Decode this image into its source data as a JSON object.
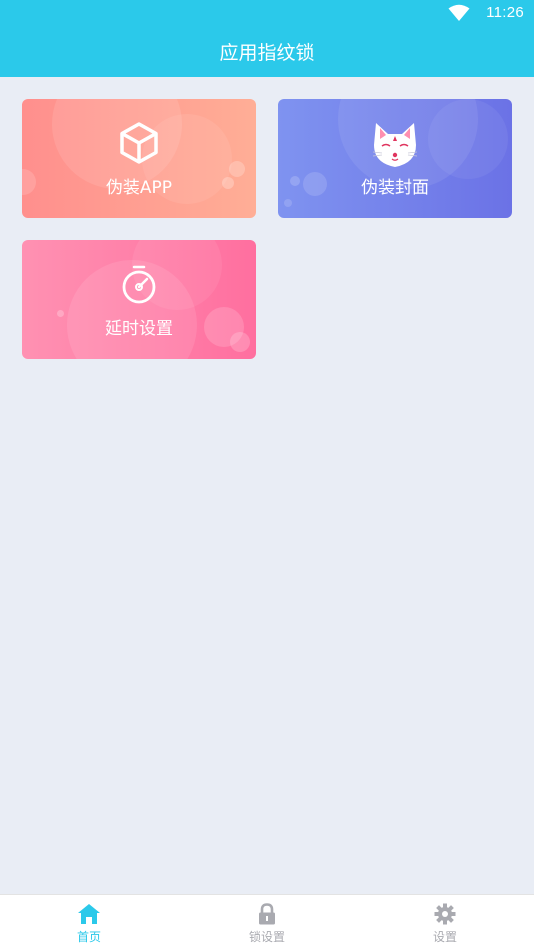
{
  "status_bar": {
    "time": "11:26",
    "wifi_icon": "wifi-icon"
  },
  "header": {
    "title": "应用指纹锁"
  },
  "cards": [
    {
      "label": "伪装APP",
      "icon": "cube-icon"
    },
    {
      "label": "伪装封面",
      "icon": "fox-mask-icon"
    },
    {
      "label": "延时设置",
      "icon": "stopwatch-icon"
    }
  ],
  "bottom_nav": {
    "active_color": "#2bc9ea",
    "inactive_color": "#a9aab0",
    "items": [
      {
        "label": "首页",
        "icon": "home-icon",
        "active": true
      },
      {
        "label": "锁设置",
        "icon": "lock-icon",
        "active": false
      },
      {
        "label": "设置",
        "icon": "gear-icon",
        "active": false
      }
    ]
  }
}
